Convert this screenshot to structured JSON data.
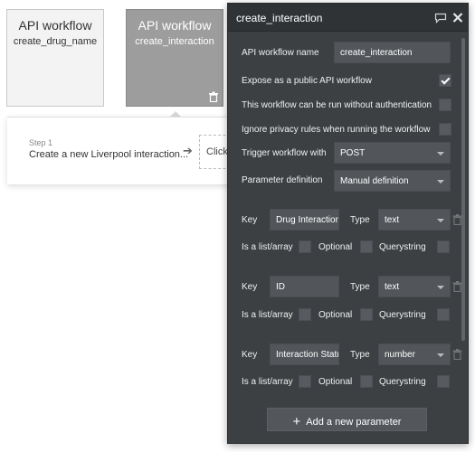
{
  "canvas": {
    "card_a": {
      "title": "API workflow",
      "subtitle": "create_drug_name"
    },
    "card_b": {
      "title": "API workflow",
      "subtitle": "create_interaction"
    },
    "step": {
      "label": "Step 1",
      "title": "Create a new Liverpool interaction...",
      "action": "Click"
    }
  },
  "panel": {
    "title": "create_interaction",
    "icons": [
      "chat-icon",
      "close-icon"
    ],
    "workflow_name_label": "API workflow name",
    "workflow_name_value": "create_interaction",
    "expose_label": "Expose as a public API workflow",
    "expose_checked": true,
    "no_auth_label": "This workflow can be run without authentication",
    "no_auth_checked": false,
    "ignore_privacy_label": "Ignore privacy rules when running the workflow",
    "ignore_privacy_checked": false,
    "trigger_label": "Trigger workflow with",
    "trigger_value": "POST",
    "param_def_label": "Parameter definition",
    "param_def_value": "Manual definition",
    "params": [
      {
        "key_label": "Key",
        "key_value": "Drug Interaction",
        "type_label": "Type",
        "type_value": "text",
        "list_label": "Is a list/array",
        "optional_label": "Optional",
        "query_label": "Querystring"
      },
      {
        "key_label": "Key",
        "key_value": "ID",
        "type_label": "Type",
        "type_value": "text",
        "list_label": "Is a list/array",
        "optional_label": "Optional",
        "query_label": "Querystring"
      },
      {
        "key_label": "Key",
        "key_value": "Interaction Statu",
        "type_label": "Type",
        "type_value": "number",
        "list_label": "Is a list/array",
        "optional_label": "Optional",
        "query_label": "Querystring"
      }
    ],
    "add_param_label": "Add a new parameter"
  },
  "colors": {
    "panel_bg": "#3c4043",
    "header_bg": "#303336",
    "field_bg": "#52565a"
  }
}
